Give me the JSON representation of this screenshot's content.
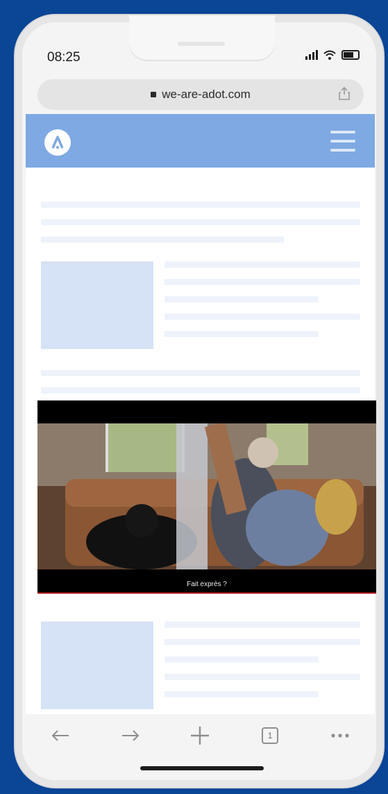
{
  "status_bar": {
    "time": "08:25"
  },
  "browser": {
    "url": "we-are-adot.com",
    "tab_count": "1",
    "icons": [
      "lock-icon",
      "share-icon",
      "back-arrow-icon",
      "forward-arrow-icon",
      "new-tab-plus-icon",
      "tabs-icon",
      "more-icon"
    ]
  },
  "site": {
    "header_color": "#7ea9e2",
    "icons": [
      "adot-logo-icon",
      "hamburger-menu-icon"
    ]
  },
  "video": {
    "subtitle": "Fait exprès ?"
  }
}
